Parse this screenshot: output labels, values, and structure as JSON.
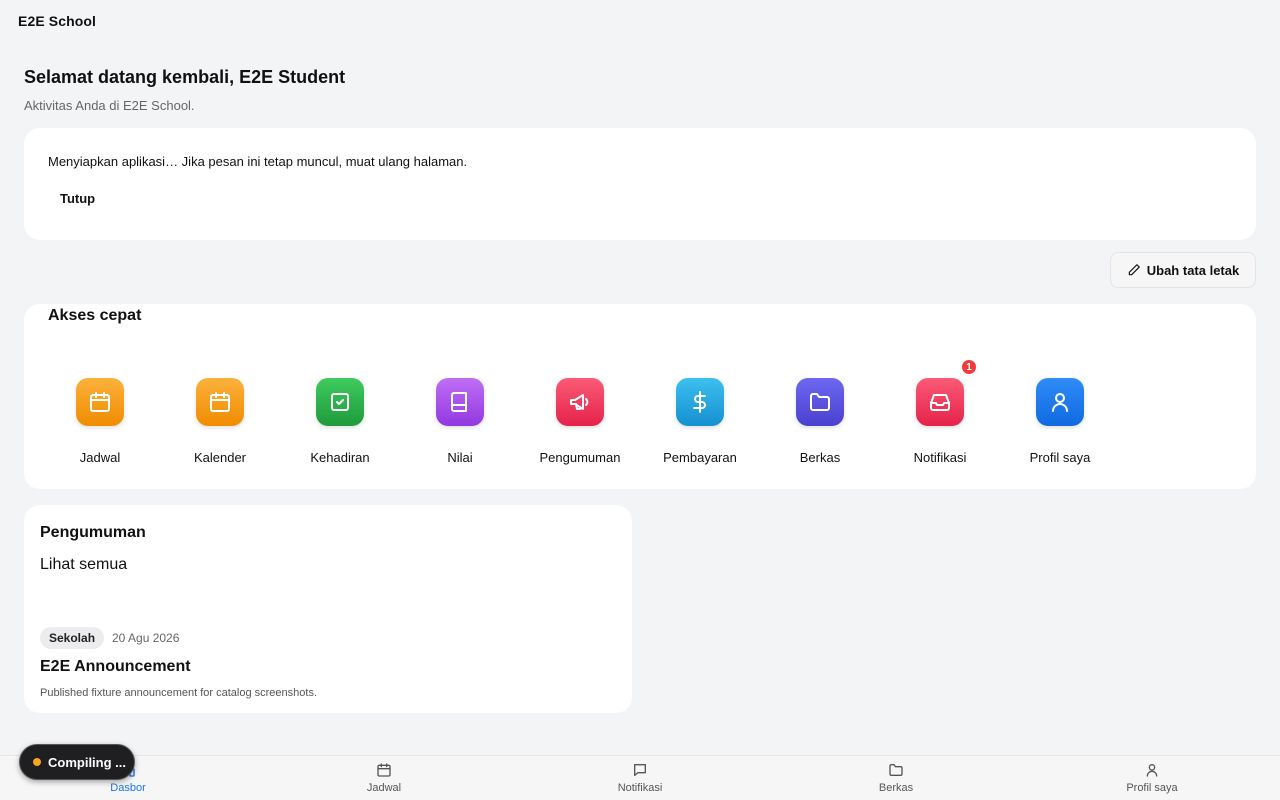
{
  "app": {
    "title": "E2E School"
  },
  "header": {
    "greeting": "Selamat datang kembali, E2E Student",
    "subtitle": "Aktivitas Anda di E2E School."
  },
  "notice": {
    "message": "Menyiapkan aplikasi… Jika pesan ini tetap muncul, muat ulang halaman.",
    "close_label": "Tutup"
  },
  "layout_button": {
    "label": "Ubah tata letak",
    "icon": "pencil-icon"
  },
  "quick_access": {
    "title": "Akses cepat",
    "items": [
      {
        "label": "Jadwal",
        "icon": "calendar-icon",
        "color": "#f59e0b"
      },
      {
        "label": "Kalender",
        "icon": "calendar-icon",
        "color": "#f59e0b"
      },
      {
        "label": "Kehadiran",
        "icon": "check-square-icon",
        "color": "#22a244"
      },
      {
        "label": "Nilai",
        "icon": "book-icon",
        "color": "#a855f7"
      },
      {
        "label": "Pengumuman",
        "icon": "megaphone-icon",
        "color": "#f43f5e"
      },
      {
        "label": "Pembayaran",
        "icon": "dollar-icon",
        "color": "#1fa5e0"
      },
      {
        "label": "Berkas",
        "icon": "folder-icon",
        "color": "#5b55e0"
      },
      {
        "label": "Notifikasi",
        "icon": "inbox-icon",
        "color": "#f43f5e",
        "badge": "1"
      },
      {
        "label": "Profil saya",
        "icon": "user-icon",
        "color": "#1a7cf0"
      }
    ]
  },
  "announcements": {
    "title": "Pengumuman",
    "see_all": "Lihat semua",
    "latest": {
      "tag": "Sekolah",
      "date": "20 Agu 2026",
      "headline": "E2E Announcement",
      "description": "Published fixture announcement for catalog screenshots."
    }
  },
  "tabbar": {
    "active": "Dasbor",
    "tabs": [
      {
        "label": "Dasbor",
        "icon": "home-icon"
      },
      {
        "label": "Jadwal",
        "icon": "calendar-icon"
      },
      {
        "label": "Notifikasi",
        "icon": "chat-icon"
      },
      {
        "label": "Berkas",
        "icon": "folder-icon"
      },
      {
        "label": "Profil saya",
        "icon": "user-icon"
      }
    ]
  },
  "toast": {
    "label": "Compiling ...",
    "dot_color": "#f5a623"
  }
}
